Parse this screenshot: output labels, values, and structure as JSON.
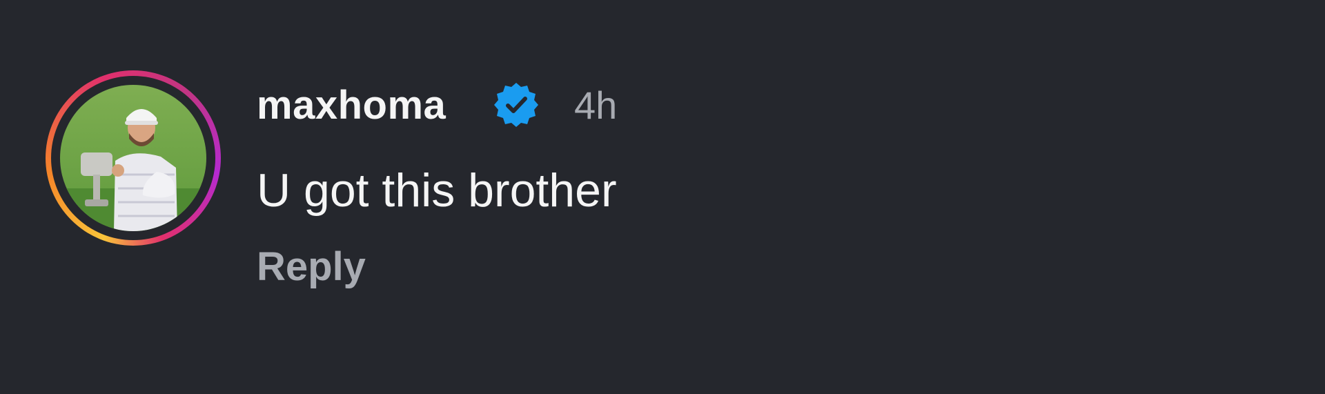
{
  "comment": {
    "username": "maxhoma",
    "verified": true,
    "timestamp": "4h",
    "text": "U got this brother",
    "reply_label": "Reply",
    "avatar": {
      "icon": "profile-photo",
      "ring_colors": [
        "#f9c43a",
        "#f58529",
        "#e1306c",
        "#c13584",
        "#b52ad0"
      ]
    }
  },
  "colors": {
    "background": "#25272d",
    "text_primary": "#f5f5f5",
    "text_secondary": "#a8abb2",
    "verified_badge": "#1a9cf0"
  }
}
